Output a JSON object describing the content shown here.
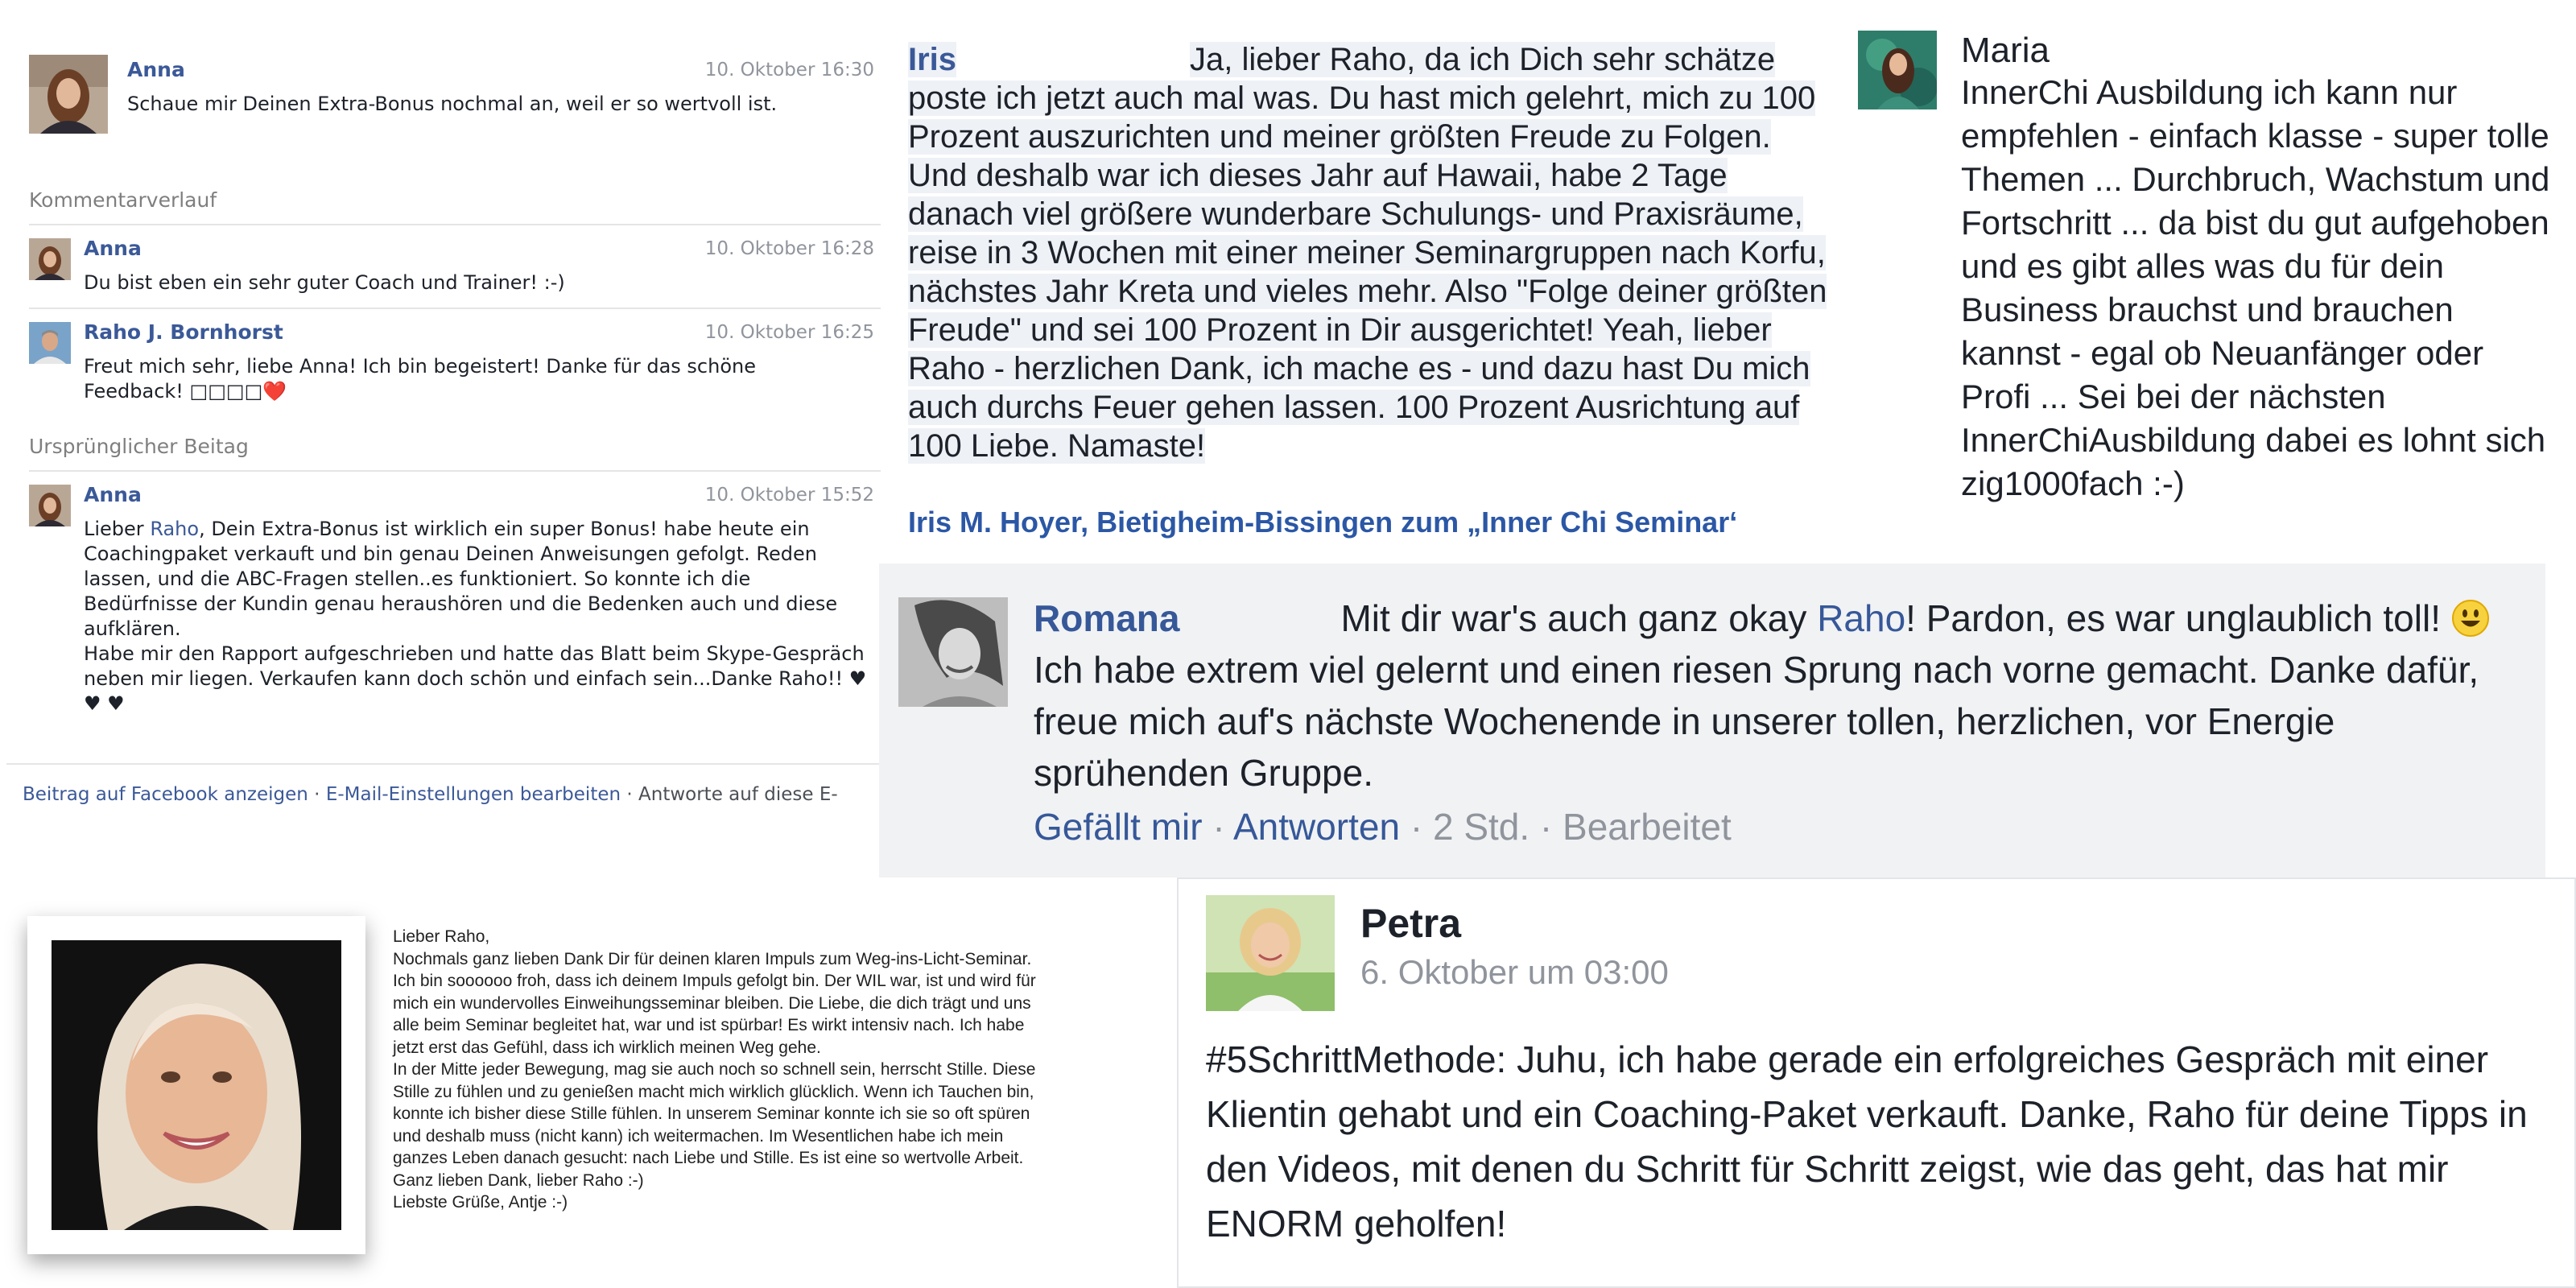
{
  "panel_anna": {
    "top_comment": {
      "name": "Anna",
      "time": "10. Oktober 16:30",
      "text": "Schaue mir Deinen Extra-Bonus nochmal an, weil er so wertvoll ist."
    },
    "history_heading": "Kommentarverlauf",
    "history": [
      {
        "name": "Anna",
        "time": "10. Oktober 16:28",
        "text": "Du bist eben ein sehr guter Coach und Trainer! :-)"
      },
      {
        "name": "Raho J. Bornhorst",
        "time": "10. Oktober 16:25",
        "text_line1": "Freut mich sehr, liebe Anna! Ich bin begeistert! Danke für das schöne",
        "text_line2": "Feedback! □□□□",
        "heart": "❤️"
      }
    ],
    "original_heading": "Ursprünglicher Beitag",
    "original": {
      "name": "Anna",
      "time": "10. Oktober 15:52",
      "text_before_link": "Lieber ",
      "link": "Raho",
      "text_after_link": ", Dein Extra-Bonus ist wirklich ein super Bonus! habe heute ein Coachingpaket verkauft und bin genau Deinen Anweisungen gefolgt. Reden lassen, und die ABC-Fragen stellen..es funktioniert. So konnte ich die Bedürfnisse der Kundin genau heraushören und die Bedenken auch und diese aufklären.",
      "text_line2": "Habe mir den Rapport aufgeschrieben und hatte das Blatt beim Skype-Gespräch neben mir liegen. Verkaufen kann doch schön und einfach sein...Danke Raho!! ♥ ♥ ♥"
    },
    "footer": {
      "link1": "Beitrag auf Facebook anzeigen",
      "sep1": " · ",
      "link2": "E-Mail-Einstellungen bearbeiten",
      "sep2": " · ",
      "tail": "Antworte auf diese E-"
    }
  },
  "panel_iris": {
    "name": "Iris",
    "text": "Ja, lieber Raho, da ich Dich sehr schätze poste ich jetzt auch mal was. Du hast mich gelehrt, mich zu 100 Prozent auszurichten und meiner größten Freude zu Folgen. Und deshalb war ich dieses Jahr auf Hawaii, habe 2 Tage danach viel größere wunderbare Schulungs- und Praxisräume, reise in 3 Wochen mit einer meiner Seminargruppen nach Korfu, nächstes Jahr Kreta und vieles mehr. Also \"Folge deiner größten Freude\" und sei 100 Prozent in Dir ausgerichtet! Yeah, lieber Raho - herzlichen Dank, ich mache es - und dazu hast Du mich auch durchs Feuer gehen lassen. 100 Prozent Ausrichtung auf 100 Liebe. Namaste!",
    "signature": "Iris M. Hoyer, Bietigheim-Bissingen zum „Inner Chi Seminar‘"
  },
  "panel_maria": {
    "name": "Maria",
    "text": "InnerChi Ausbildung ich kann nur empfehlen - einfach klasse - super tolle Themen ... Durchbruch, Wachstum und Fortschritt ... da bist du gut aufgehoben und es gibt alles was du für dein Business brauchst und brauchen kannst - egal ob Neuanfänger oder Profi ... Sei bei der nächsten InnerChiAusbildung dabei es lohnt sich zig1000fach :-)"
  },
  "panel_romana": {
    "name": "Romana",
    "text_before_link": "Mit dir war's auch ganz okay ",
    "link": "Raho",
    "text_middle": "! Pardon, es war unglaublich toll! ",
    "emoji": "😃",
    "text_after": " Ich habe extrem viel gelernt und einen riesen Sprung nach vorne gemacht. Danke dafür, freue mich auf's nächste Wochenende in unserer tollen, herzlichen, vor Energie sprühenden Gruppe.",
    "actions": {
      "like": "Gefällt mir",
      "sep": " · ",
      "reply": "Antworten",
      "time": "2 Std.",
      "edited": "Bearbeitet"
    }
  },
  "panel_antje": {
    "lines": [
      "Lieber Raho,",
      "Nochmals ganz lieben Dank Dir für deinen klaren Impuls zum Weg-ins-Licht-Seminar.",
      "Ich bin soooooo froh, dass ich deinem Impuls gefolgt bin. Der WIL war, ist und wird für",
      "mich ein wundervolles Einweihungsseminar bleiben. Die Liebe, die dich trägt und uns",
      "alle beim Seminar begleitet hat, war und ist spürbar! Es wirkt intensiv nach. Ich habe",
      "jetzt erst das Gefühl, dass ich wirklich meinen Weg gehe.",
      "In der Mitte jeder Bewegung, mag sie auch noch so schnell sein, herrscht Stille. Diese",
      "Stille zu fühlen und zu genießen macht mich wirklich glücklich. Wenn ich Tauchen bin,",
      "konnte ich bisher diese Stille fühlen. In unserem Seminar konnte ich sie so oft spüren",
      "und deshalb muss (nicht kann) ich weitermachen. Im Wesentlichen habe ich mein",
      "ganzes Leben danach gesucht: nach Liebe und Stille.  Es ist eine so wertvolle Arbeit.",
      "Ganz lieben Dank, lieber Raho :-)",
      "Liebste Grüße, Antje :-)"
    ]
  },
  "panel_petra": {
    "name": "Petra",
    "time": "6. Oktober um 03:00",
    "text": "#5SchrittMethode: Juhu, ich habe gerade ein erfolgreiches Gespräch mit einer Klientin gehabt und ein Coaching-Paket verkauft. Danke, Raho für deine Tipps in den Videos, mit denen du Schritt für Schritt zeigst, wie das geht, das hat mir ENORM geholfen!"
  },
  "colors": {
    "facebook_blue": "#3b5998",
    "link_blue": "#365899",
    "gray_text": "#90949c",
    "comment_bg": "#f1f2f4"
  },
  "icons": [
    "avatar-anna",
    "avatar-raho",
    "avatar-maria",
    "avatar-romana",
    "avatar-petra",
    "photo-antje",
    "smiley-emoji",
    "heart-emoji"
  ]
}
